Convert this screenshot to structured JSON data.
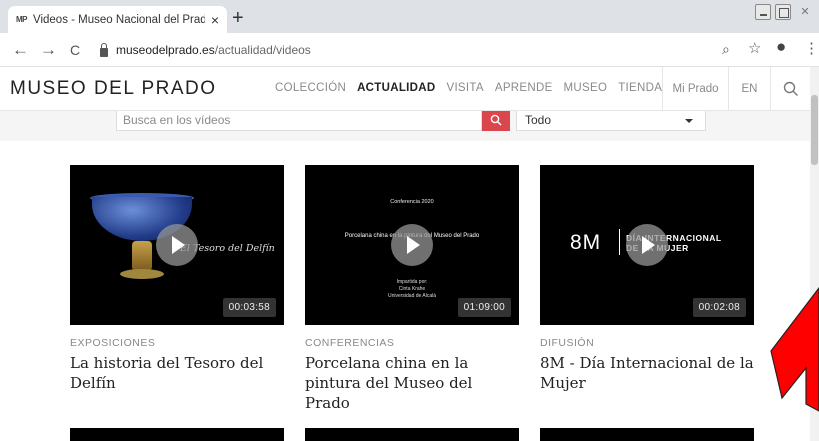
{
  "browser": {
    "tab_favicon": "MP",
    "tab_title": "Videos - Museo Nacional del Prado",
    "tab_close": "×",
    "new_tab": "+",
    "back_icon": "←",
    "forward_icon": "→",
    "reload_icon": "C",
    "url_host": "museodelprado.es",
    "url_path": "/actualidad/videos",
    "zoom_icon": "⌕",
    "star_icon": "☆",
    "account_icon": "●",
    "menu_icon": "⋮"
  },
  "site": {
    "logo": "MUSEO DEL PRADO",
    "nav": [
      "COLECCIÓN",
      "ACTUALIDAD",
      "VISITA",
      "APRENDE",
      "MUSEO",
      "TIENDA"
    ],
    "active_nav": "ACTUALIDAD",
    "mi_prado": "Mi Prado",
    "lang": "EN",
    "search_icon": "search-icon"
  },
  "filters": {
    "search_placeholder": "Busca en los vídeos",
    "select_value": "Todo"
  },
  "videos": [
    {
      "category": "EXPOSICIONES",
      "title": "La historia del Tesoro del Delfín",
      "duration": "00:03:58",
      "thumb_caption": "El Tesoro del Delfín"
    },
    {
      "category": "CONFERENCIAS",
      "title": "Porcelana china en la pintura del Museo del Prado",
      "duration": "01:09:00",
      "thumb_top": "Conferencia 2020",
      "thumb_title": "Porcelana china en la pintura del Museo del Prado",
      "thumb_by_1": "Impartida por:",
      "thumb_by_2": "Cinta Krahe",
      "thumb_by_3": "Universidad de Alcalá"
    },
    {
      "category": "DIFUSIÓN",
      "title": "8M - Día Internacional de la Mujer",
      "duration": "00:02:08",
      "thumb_logo": "8M",
      "thumb_text_1": "DÍA INTERNACIONAL",
      "thumb_text_2": "DE LA MUJER"
    }
  ],
  "colors": {
    "accent_red": "#d9464c",
    "annotation_arrow": "#ff0000"
  }
}
